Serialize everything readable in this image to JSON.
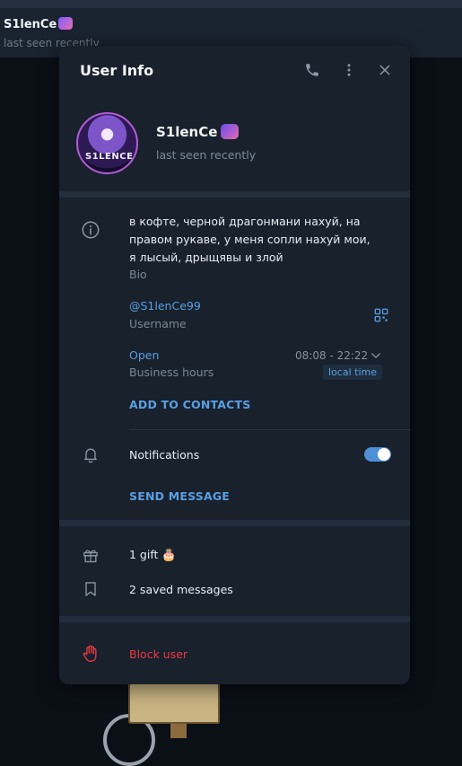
{
  "background": {
    "chat_name": "S1lenCe",
    "chat_status": "last seen recently"
  },
  "modal": {
    "title": "User Info",
    "icons": [
      "phone-icon",
      "more-icon",
      "close-icon"
    ]
  },
  "profile": {
    "name": "S1lenCe",
    "status": "last seen recently",
    "avatar_text": "S1LENCE"
  },
  "info": {
    "bio_text": "в кофте, черной драгонмани нахуй, на правом рукаве, у меня сопли нахуй мои, я лысый, дрыщявы и злой",
    "bio_label": "Bio",
    "username": "@S1lenCe99",
    "username_label": "Username",
    "business_status": "Open",
    "business_label": "Business hours",
    "business_time": "08:08 - 22:22",
    "local_time_badge": "local time",
    "add_contacts": "ADD TO CONTACTS"
  },
  "notifications": {
    "label": "Notifications",
    "enabled": true,
    "send_message": "SEND MESSAGE"
  },
  "extras": {
    "gifts": "1 gift",
    "saved": "2 saved messages"
  },
  "danger": {
    "block": "Block user"
  },
  "colors": {
    "accent": "#5a9fe3",
    "danger": "#ec3942",
    "panel": "#18212c",
    "background": "#0b1017"
  }
}
